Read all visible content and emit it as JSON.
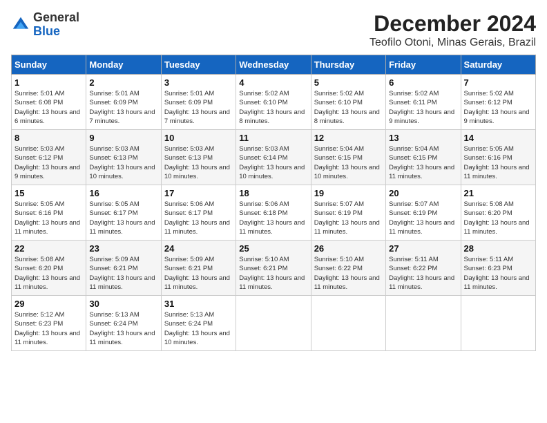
{
  "header": {
    "logo_general": "General",
    "logo_blue": "Blue",
    "title": "December 2024",
    "subtitle": "Teofilo Otoni, Minas Gerais, Brazil"
  },
  "days_of_week": [
    "Sunday",
    "Monday",
    "Tuesday",
    "Wednesday",
    "Thursday",
    "Friday",
    "Saturday"
  ],
  "weeks": [
    [
      {
        "day": 1,
        "sunrise": "5:01 AM",
        "sunset": "6:08 PM",
        "daylight": "13 hours and 6 minutes."
      },
      {
        "day": 2,
        "sunrise": "5:01 AM",
        "sunset": "6:09 PM",
        "daylight": "13 hours and 7 minutes."
      },
      {
        "day": 3,
        "sunrise": "5:01 AM",
        "sunset": "6:09 PM",
        "daylight": "13 hours and 7 minutes."
      },
      {
        "day": 4,
        "sunrise": "5:02 AM",
        "sunset": "6:10 PM",
        "daylight": "13 hours and 8 minutes."
      },
      {
        "day": 5,
        "sunrise": "5:02 AM",
        "sunset": "6:10 PM",
        "daylight": "13 hours and 8 minutes."
      },
      {
        "day": 6,
        "sunrise": "5:02 AM",
        "sunset": "6:11 PM",
        "daylight": "13 hours and 9 minutes."
      },
      {
        "day": 7,
        "sunrise": "5:02 AM",
        "sunset": "6:12 PM",
        "daylight": "13 hours and 9 minutes."
      }
    ],
    [
      {
        "day": 8,
        "sunrise": "5:03 AM",
        "sunset": "6:12 PM",
        "daylight": "13 hours and 9 minutes."
      },
      {
        "day": 9,
        "sunrise": "5:03 AM",
        "sunset": "6:13 PM",
        "daylight": "13 hours and 10 minutes."
      },
      {
        "day": 10,
        "sunrise": "5:03 AM",
        "sunset": "6:13 PM",
        "daylight": "13 hours and 10 minutes."
      },
      {
        "day": 11,
        "sunrise": "5:03 AM",
        "sunset": "6:14 PM",
        "daylight": "13 hours and 10 minutes."
      },
      {
        "day": 12,
        "sunrise": "5:04 AM",
        "sunset": "6:15 PM",
        "daylight": "13 hours and 10 minutes."
      },
      {
        "day": 13,
        "sunrise": "5:04 AM",
        "sunset": "6:15 PM",
        "daylight": "13 hours and 11 minutes."
      },
      {
        "day": 14,
        "sunrise": "5:05 AM",
        "sunset": "6:16 PM",
        "daylight": "13 hours and 11 minutes."
      }
    ],
    [
      {
        "day": 15,
        "sunrise": "5:05 AM",
        "sunset": "6:16 PM",
        "daylight": "13 hours and 11 minutes."
      },
      {
        "day": 16,
        "sunrise": "5:05 AM",
        "sunset": "6:17 PM",
        "daylight": "13 hours and 11 minutes."
      },
      {
        "day": 17,
        "sunrise": "5:06 AM",
        "sunset": "6:17 PM",
        "daylight": "13 hours and 11 minutes."
      },
      {
        "day": 18,
        "sunrise": "5:06 AM",
        "sunset": "6:18 PM",
        "daylight": "13 hours and 11 minutes."
      },
      {
        "day": 19,
        "sunrise": "5:07 AM",
        "sunset": "6:19 PM",
        "daylight": "13 hours and 11 minutes."
      },
      {
        "day": 20,
        "sunrise": "5:07 AM",
        "sunset": "6:19 PM",
        "daylight": "13 hours and 11 minutes."
      },
      {
        "day": 21,
        "sunrise": "5:08 AM",
        "sunset": "6:20 PM",
        "daylight": "13 hours and 11 minutes."
      }
    ],
    [
      {
        "day": 22,
        "sunrise": "5:08 AM",
        "sunset": "6:20 PM",
        "daylight": "13 hours and 11 minutes."
      },
      {
        "day": 23,
        "sunrise": "5:09 AM",
        "sunset": "6:21 PM",
        "daylight": "13 hours and 11 minutes."
      },
      {
        "day": 24,
        "sunrise": "5:09 AM",
        "sunset": "6:21 PM",
        "daylight": "13 hours and 11 minutes."
      },
      {
        "day": 25,
        "sunrise": "5:10 AM",
        "sunset": "6:21 PM",
        "daylight": "13 hours and 11 minutes."
      },
      {
        "day": 26,
        "sunrise": "5:10 AM",
        "sunset": "6:22 PM",
        "daylight": "13 hours and 11 minutes."
      },
      {
        "day": 27,
        "sunrise": "5:11 AM",
        "sunset": "6:22 PM",
        "daylight": "13 hours and 11 minutes."
      },
      {
        "day": 28,
        "sunrise": "5:11 AM",
        "sunset": "6:23 PM",
        "daylight": "13 hours and 11 minutes."
      }
    ],
    [
      {
        "day": 29,
        "sunrise": "5:12 AM",
        "sunset": "6:23 PM",
        "daylight": "13 hours and 11 minutes."
      },
      {
        "day": 30,
        "sunrise": "5:13 AM",
        "sunset": "6:24 PM",
        "daylight": "13 hours and 11 minutes."
      },
      {
        "day": 31,
        "sunrise": "5:13 AM",
        "sunset": "6:24 PM",
        "daylight": "13 hours and 10 minutes."
      },
      null,
      null,
      null,
      null
    ]
  ]
}
